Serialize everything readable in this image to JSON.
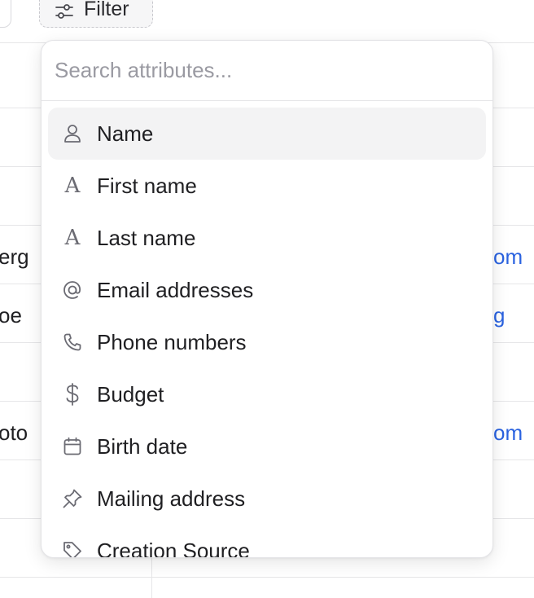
{
  "toolbar": {
    "filter_label": "Filter"
  },
  "background": {
    "row_texts": [
      "erg",
      "oe",
      "oto"
    ],
    "row_links": [
      "om",
      "g",
      "om",
      "@"
    ]
  },
  "filter_menu": {
    "search_placeholder": "Search attributes...",
    "search_value": "",
    "items": [
      {
        "label": "Name",
        "icon": "person-icon",
        "active": true
      },
      {
        "label": "First name",
        "icon": "text-a-icon",
        "active": false
      },
      {
        "label": "Last name",
        "icon": "text-a-icon",
        "active": false
      },
      {
        "label": "Email addresses",
        "icon": "at-icon",
        "active": false
      },
      {
        "label": "Phone numbers",
        "icon": "phone-icon",
        "active": false
      },
      {
        "label": "Budget",
        "icon": "dollar-icon",
        "active": false
      },
      {
        "label": "Birth date",
        "icon": "calendar-icon",
        "active": false
      },
      {
        "label": "Mailing address",
        "icon": "pin-icon",
        "active": false
      },
      {
        "label": "Creation Source",
        "icon": "tag-icon",
        "active": false
      }
    ]
  },
  "colors": {
    "link": "#2b63e0",
    "active_row": "#f3f3f4",
    "icon": "#6b6b73"
  }
}
